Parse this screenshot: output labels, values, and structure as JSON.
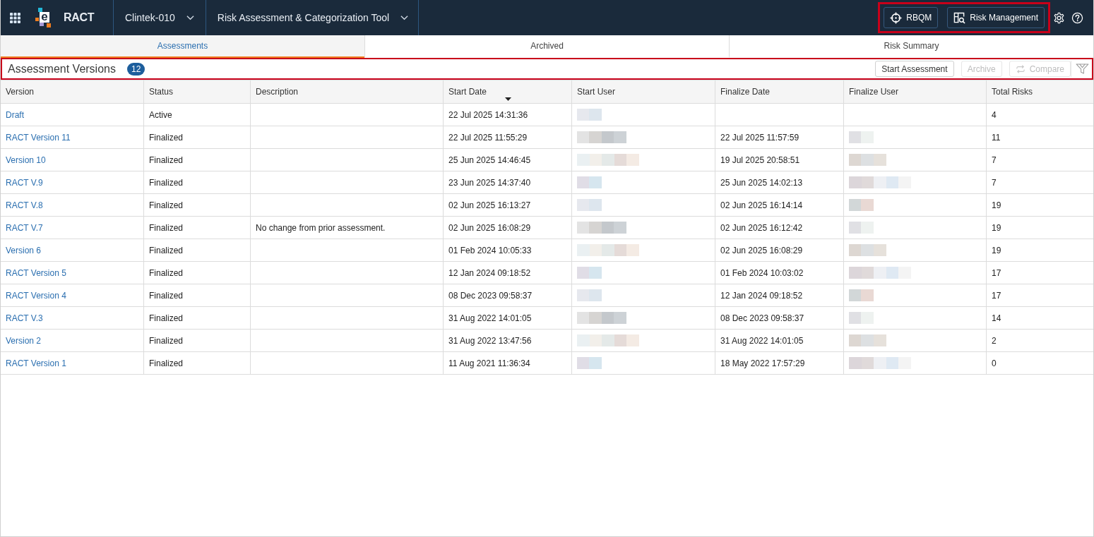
{
  "app_bar": {
    "logo_letter": "e",
    "app_name": "RACT",
    "study_selector": {
      "label": "Clintek-010"
    },
    "tool_selector": {
      "label": "Risk Assessment & Categorization Tool"
    },
    "actions_highlighted": true,
    "actions": [
      {
        "label": "RBQM",
        "kind": "target"
      },
      {
        "label": "Risk Management",
        "kind": "review"
      }
    ]
  },
  "tabs": [
    {
      "label": "Assessments",
      "selected": true
    },
    {
      "label": "Archived",
      "selected": false
    },
    {
      "label": "Risk Summary",
      "selected": false
    }
  ],
  "toolbar": {
    "title": "Assessment Versions",
    "count": "12",
    "highlighted": true,
    "buttons": [
      {
        "label": "Start Assessment",
        "kind": "plain",
        "disabled": false
      },
      {
        "label": "Archive",
        "kind": "plain",
        "disabled": true
      },
      {
        "label": "Compare",
        "kind": "compare",
        "disabled": true
      }
    ]
  },
  "table": {
    "columns": [
      {
        "label": "Version",
        "sorted": false
      },
      {
        "label": "Status",
        "sorted": false
      },
      {
        "label": "Description",
        "sorted": false
      },
      {
        "label": "Start Date",
        "sorted": true
      },
      {
        "label": "Start User",
        "sorted": false
      },
      {
        "label": "Finalize Date",
        "sorted": false
      },
      {
        "label": "Finalize User",
        "sorted": false
      },
      {
        "label": "Total Risks",
        "sorted": false
      }
    ],
    "rows": [
      {
        "version": "Draft",
        "status": "Active",
        "start_date": "22 Jul 2025 14:31:36",
        "start_user": {
          "redacted": true
        },
        "finalize_user": {
          "redacted": false
        },
        "total_risks": "4"
      },
      {
        "version": "RACT Version 11",
        "status": "Finalized",
        "start_date": "22 Jul 2025 11:55:29",
        "start_user": {
          "redacted": true
        },
        "finalize_date": "22 Jul 2025 11:57:59",
        "finalize_user": {
          "redacted": true
        },
        "total_risks": "11"
      },
      {
        "version": "Version 10",
        "status": "Finalized",
        "start_date": "25 Jun 2025 14:46:45",
        "start_user": {
          "redacted": true
        },
        "finalize_date": "19 Jul 2025 20:58:51",
        "finalize_user": {
          "redacted": true
        },
        "total_risks": "7"
      },
      {
        "version": "RACT V.9",
        "status": "Finalized",
        "start_date": "23 Jun 2025 14:37:40",
        "start_user": {
          "redacted": true
        },
        "finalize_date": "25 Jun 2025 14:02:13",
        "finalize_user": {
          "redacted": true
        },
        "total_risks": "7"
      },
      {
        "version": "RACT V.8",
        "status": "Finalized",
        "start_date": "02 Jun 2025 16:13:27",
        "start_user": {
          "redacted": true
        },
        "finalize_date": "02 Jun 2025 16:14:14",
        "finalize_user": {
          "redacted": true
        },
        "total_risks": "19"
      },
      {
        "version": "RACT V.7",
        "status": "Finalized",
        "description": "No change from prior assessment.",
        "start_date": "02 Jun 2025 16:08:29",
        "start_user": {
          "redacted": true
        },
        "finalize_date": "02 Jun 2025 16:12:42",
        "finalize_user": {
          "redacted": true
        },
        "total_risks": "19"
      },
      {
        "version": "Version 6",
        "status": "Finalized",
        "start_date": "01 Feb 2024 10:05:33",
        "start_user": {
          "redacted": true
        },
        "finalize_date": "02 Jun 2025 16:08:29",
        "finalize_user": {
          "redacted": true
        },
        "total_risks": "19"
      },
      {
        "version": "RACT Version 5",
        "status": "Finalized",
        "start_date": "12 Jan 2024 09:18:52",
        "start_user": {
          "redacted": true
        },
        "finalize_date": "01 Feb 2024 10:03:02",
        "finalize_user": {
          "redacted": true
        },
        "total_risks": "17"
      },
      {
        "version": "RACT Version 4",
        "status": "Finalized",
        "start_date": "08 Dec 2023 09:58:37",
        "start_user": {
          "redacted": true
        },
        "finalize_date": "12 Jan 2024 09:18:52",
        "finalize_user": {
          "redacted": true
        },
        "total_risks": "17"
      },
      {
        "version": "RACT V.3",
        "status": "Finalized",
        "start_date": "31 Aug 2022 14:01:05",
        "start_user": {
          "redacted": true
        },
        "finalize_date": "08 Dec 2023 09:58:37",
        "finalize_user": {
          "redacted": true
        },
        "total_risks": "14"
      },
      {
        "version": "Version 2",
        "status": "Finalized",
        "start_date": "31 Aug 2022 13:47:56",
        "start_user": {
          "redacted": true
        },
        "finalize_date": "31 Aug 2022 14:01:05",
        "finalize_user": {
          "redacted": true
        },
        "total_risks": "2"
      },
      {
        "version": "RACT Version 1",
        "status": "Finalized",
        "start_date": "11 Aug 2021 11:36:34",
        "start_user": {
          "redacted": true
        },
        "finalize_date": "18 May 2022 17:57:29",
        "finalize_user": {
          "redacted": true
        },
        "total_risks": "0"
      }
    ]
  }
}
